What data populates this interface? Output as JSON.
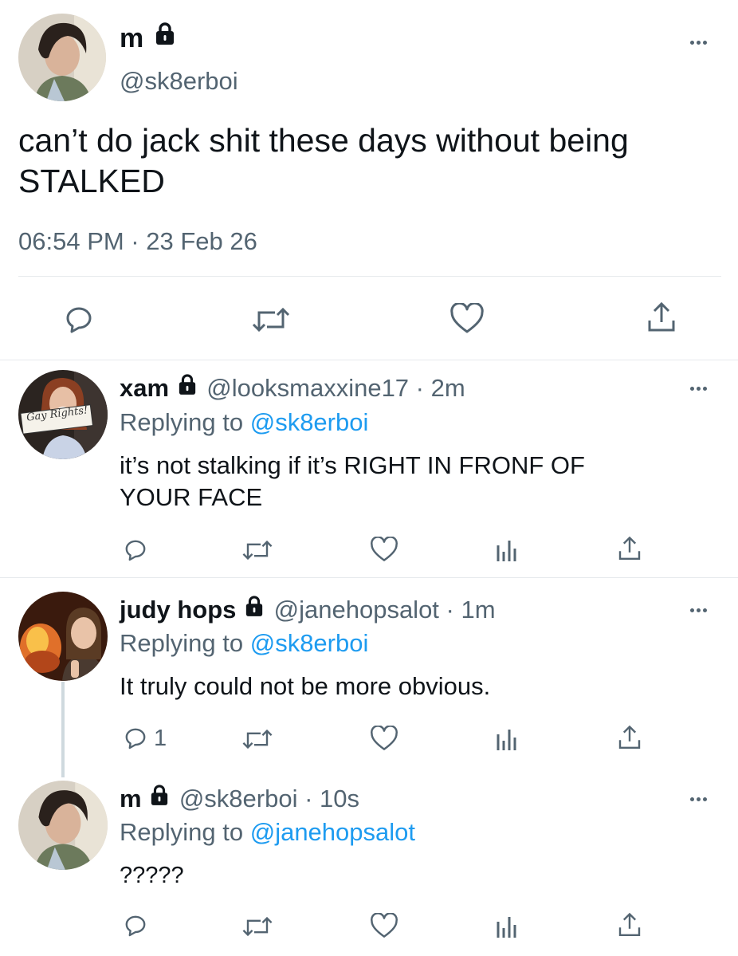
{
  "main_tweet": {
    "display_name": "m",
    "handle": "@sk8erboi",
    "text_line1": "can’t do jack shit these days without being",
    "text_line2": "STALKED",
    "timestamp": "06:54 PM · 23 Feb 26"
  },
  "replies": [
    {
      "display_name": "xam",
      "handle_time": "@looksmaxxine17 · 2m",
      "replying_label": "Replying to",
      "replying_handle": "@sk8erboi",
      "text_line1": "it’s not stalking if it’s RIGHT IN FRONF OF",
      "text_line2": "YOUR FACE",
      "sign_text": "Gay Rights!",
      "reply_count": ""
    },
    {
      "display_name": "judy hops",
      "handle_time": "@janehopsalot · 1m",
      "replying_label": "Replying to",
      "replying_handle": "@sk8erboi",
      "text_line1": "It truly could not be more obvious.",
      "reply_count": "1"
    },
    {
      "display_name": "m",
      "handle_time": "@sk8erboi · 10s",
      "replying_label": "Replying to",
      "replying_handle": "@janehopsalot",
      "text_line1": "?????",
      "reply_count": ""
    }
  ],
  "colors": {
    "text": "#0f1419",
    "secondary": "#536471",
    "accent": "#1d9bf0",
    "divider": "#e6e9ec"
  },
  "icons": [
    "lock-icon",
    "more-icon",
    "reply-icon",
    "retweet-icon",
    "like-icon",
    "analytics-icon",
    "share-icon"
  ]
}
